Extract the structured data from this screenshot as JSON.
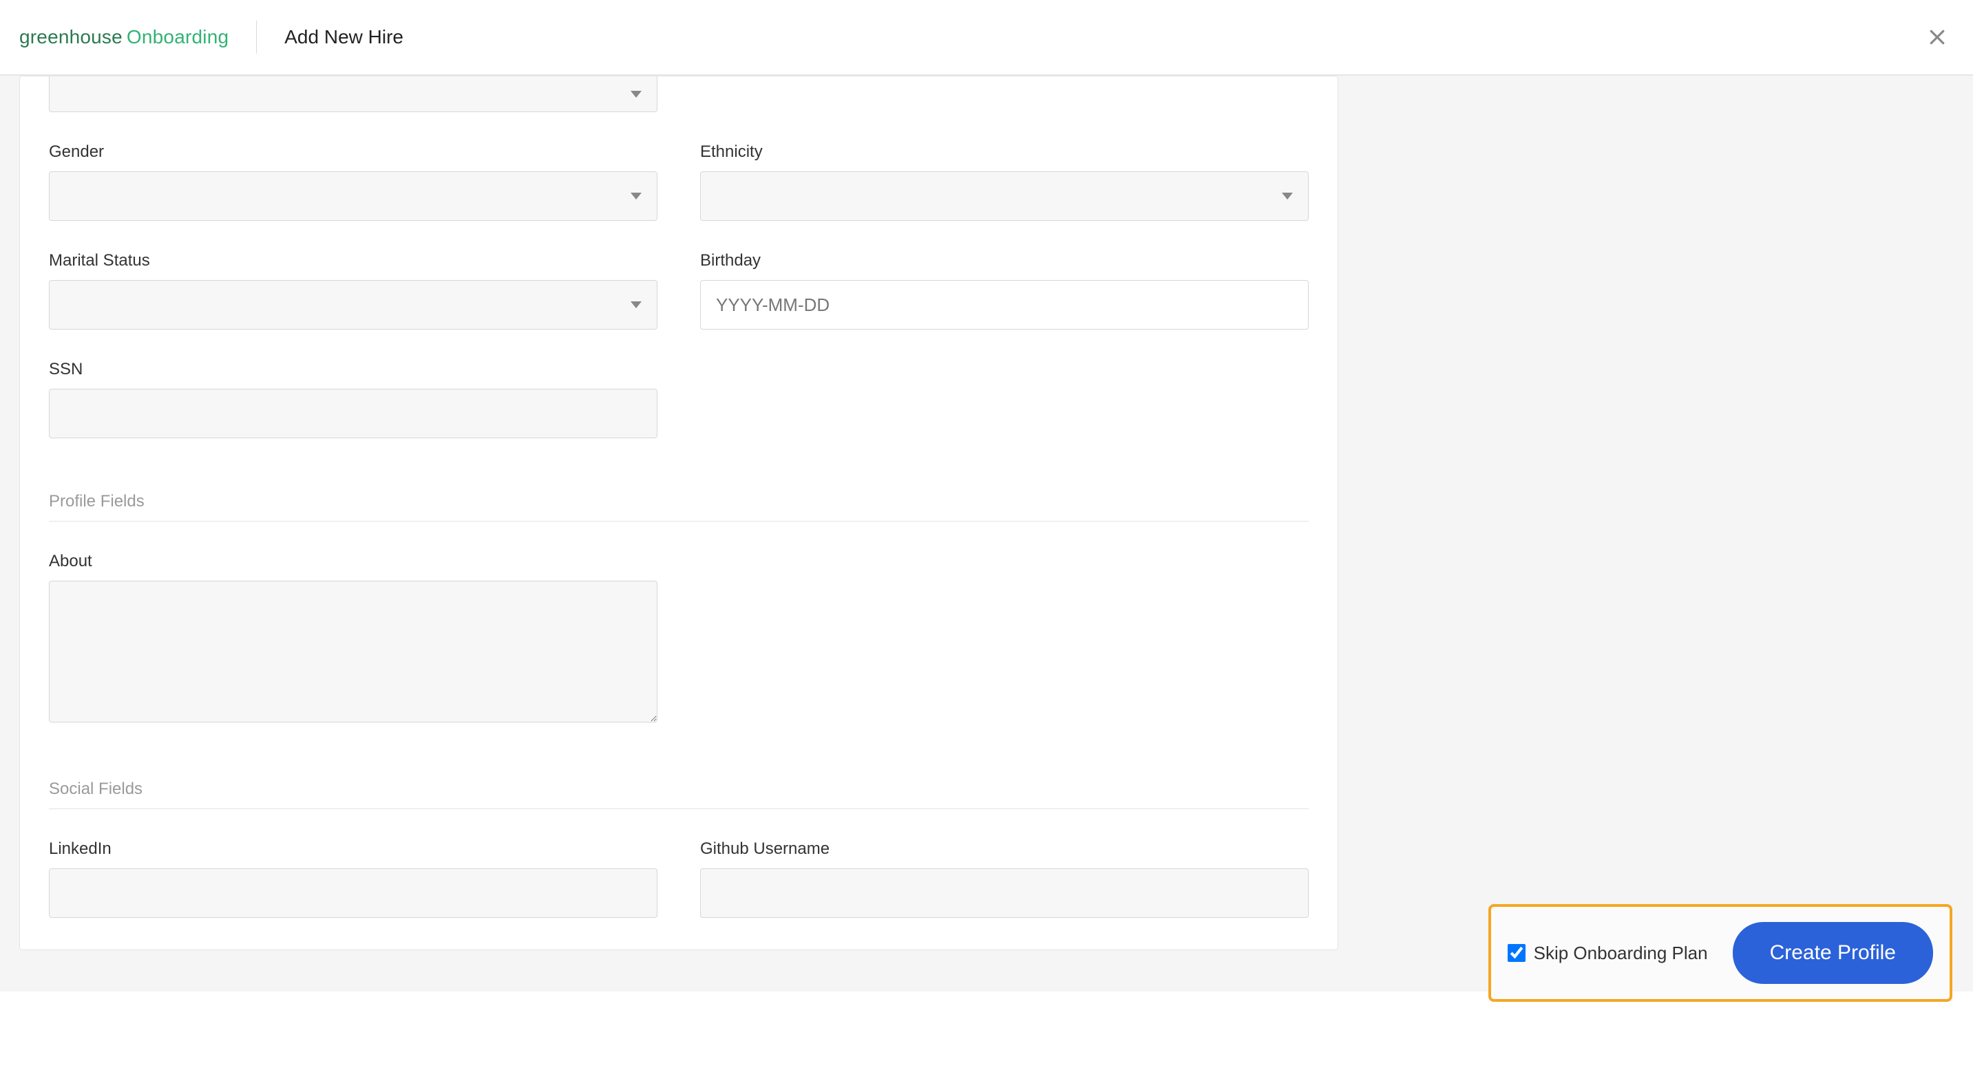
{
  "header": {
    "brand_a": "greenhouse",
    "brand_b": "Onboarding",
    "title": "Add New Hire"
  },
  "form": {
    "gender": {
      "label": "Gender",
      "value": ""
    },
    "ethnicity": {
      "label": "Ethnicity",
      "value": ""
    },
    "marital_status": {
      "label": "Marital Status",
      "value": ""
    },
    "birthday": {
      "label": "Birthday",
      "placeholder": "YYYY-MM-DD",
      "value": ""
    },
    "ssn": {
      "label": "SSN",
      "value": ""
    },
    "profile_section": "Profile Fields",
    "about": {
      "label": "About",
      "value": ""
    },
    "social_section": "Social Fields",
    "linkedin": {
      "label": "LinkedIn",
      "value": ""
    },
    "github": {
      "label": "Github Username",
      "value": ""
    }
  },
  "footer": {
    "skip_label": "Skip Onboarding Plan",
    "skip_checked": true,
    "create_label": "Create Profile"
  }
}
